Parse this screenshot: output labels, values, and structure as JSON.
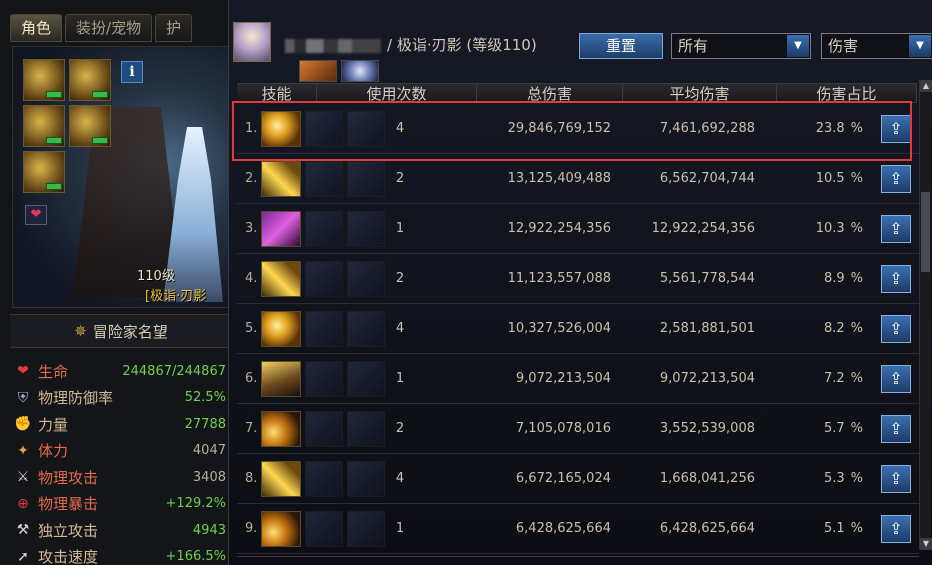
{
  "left_panel": {
    "tabs": [
      "角色",
      "装扮/宠物",
      "护"
    ],
    "level_text": "110级",
    "title_text": "[极诣·刃影",
    "fame_label": "冒险家名望",
    "stats": [
      {
        "icon": "heart-icon",
        "glyph": "❤",
        "color": "#e03a3a",
        "name": "生命",
        "value": "244867/244867",
        "value_style": "green",
        "name_style": "red"
      },
      {
        "icon": "shield-icon",
        "glyph": "⛨",
        "color": "#9ab0d8",
        "name": "物理防御率",
        "value": "52.5%",
        "value_style": "green",
        "name_style": "beige"
      },
      {
        "icon": "strength-icon",
        "glyph": "✊",
        "color": "#e3a04a",
        "name": "力量",
        "value": "27788",
        "value_style": "green",
        "name_style": "beige"
      },
      {
        "icon": "vitality-icon",
        "glyph": "✦",
        "color": "#e3a04a",
        "name": "体力",
        "value": "4047",
        "value_style": "",
        "name_style": "red"
      },
      {
        "icon": "sword-icon",
        "glyph": "⚔",
        "color": "#d8d8d8",
        "name": "物理攻击",
        "value": "3408",
        "value_style": "",
        "name_style": "red"
      },
      {
        "icon": "crit-icon",
        "glyph": "⊕",
        "color": "#e03a3a",
        "name": "物理暴击",
        "value": "+129.2%",
        "value_style": "green",
        "name_style": "red"
      },
      {
        "icon": "independent-attack-icon",
        "glyph": "⚒",
        "color": "#d8d8d8",
        "name": "独立攻击",
        "value": "4943",
        "value_style": "green",
        "name_style": "beige"
      },
      {
        "icon": "attack-speed-icon",
        "glyph": "➚",
        "color": "#d8d8d8",
        "name": "攻击速度",
        "value": "+166.5%",
        "value_style": "green",
        "name_style": "beige"
      }
    ]
  },
  "main_panel": {
    "player_name_suffix": "/ 极诣·刃影 (等级110)",
    "reset_label": "重置",
    "filter_dropdown": {
      "value": "所有"
    },
    "type_dropdown": {
      "value": "伤害"
    },
    "columns": {
      "skill": "技能",
      "uses": "使用次数",
      "total": "总伤害",
      "avg": "平均伤害",
      "pct": "伤害占比"
    },
    "rows": [
      {
        "idx": "1.",
        "skill_style": "sk-a",
        "uses": "4",
        "total": "29,846,769,152",
        "avg": "7,461,692,288",
        "pct": "23.8",
        "pct_unit": "%"
      },
      {
        "idx": "2.",
        "skill_style": "sk-c",
        "uses": "2",
        "total": "13,125,409,488",
        "avg": "6,562,704,744",
        "pct": "10.5",
        "pct_unit": "%"
      },
      {
        "idx": "3.",
        "skill_style": "sk-b",
        "uses": "1",
        "total": "12,922,254,356",
        "avg": "12,922,254,356",
        "pct": "10.3",
        "pct_unit": "%"
      },
      {
        "idx": "4.",
        "skill_style": "sk-c",
        "uses": "2",
        "total": "11,123,557,088",
        "avg": "5,561,778,544",
        "pct": "8.9",
        "pct_unit": "%"
      },
      {
        "idx": "5.",
        "skill_style": "sk-a",
        "uses": "4",
        "total": "10,327,526,004",
        "avg": "2,581,881,501",
        "pct": "8.2",
        "pct_unit": "%"
      },
      {
        "idx": "6.",
        "skill_style": "sk-e",
        "uses": "1",
        "total": "9,072,213,504",
        "avg": "9,072,213,504",
        "pct": "7.2",
        "pct_unit": "%"
      },
      {
        "idx": "7.",
        "skill_style": "sk-d",
        "uses": "2",
        "total": "7,105,078,016",
        "avg": "3,552,539,008",
        "pct": "5.7",
        "pct_unit": "%"
      },
      {
        "idx": "8.",
        "skill_style": "sk-c",
        "uses": "4",
        "total": "6,672,165,024",
        "avg": "1,668,041,256",
        "pct": "5.3",
        "pct_unit": "%"
      },
      {
        "idx": "9.",
        "skill_style": "sk-d",
        "uses": "1",
        "total": "6,428,625,664",
        "avg": "6,428,625,664",
        "pct": "5.1",
        "pct_unit": "%"
      }
    ]
  },
  "colors": {
    "highlight": "#e03a3a",
    "accent": "#3a70b0",
    "gold": "#f0c23a"
  }
}
